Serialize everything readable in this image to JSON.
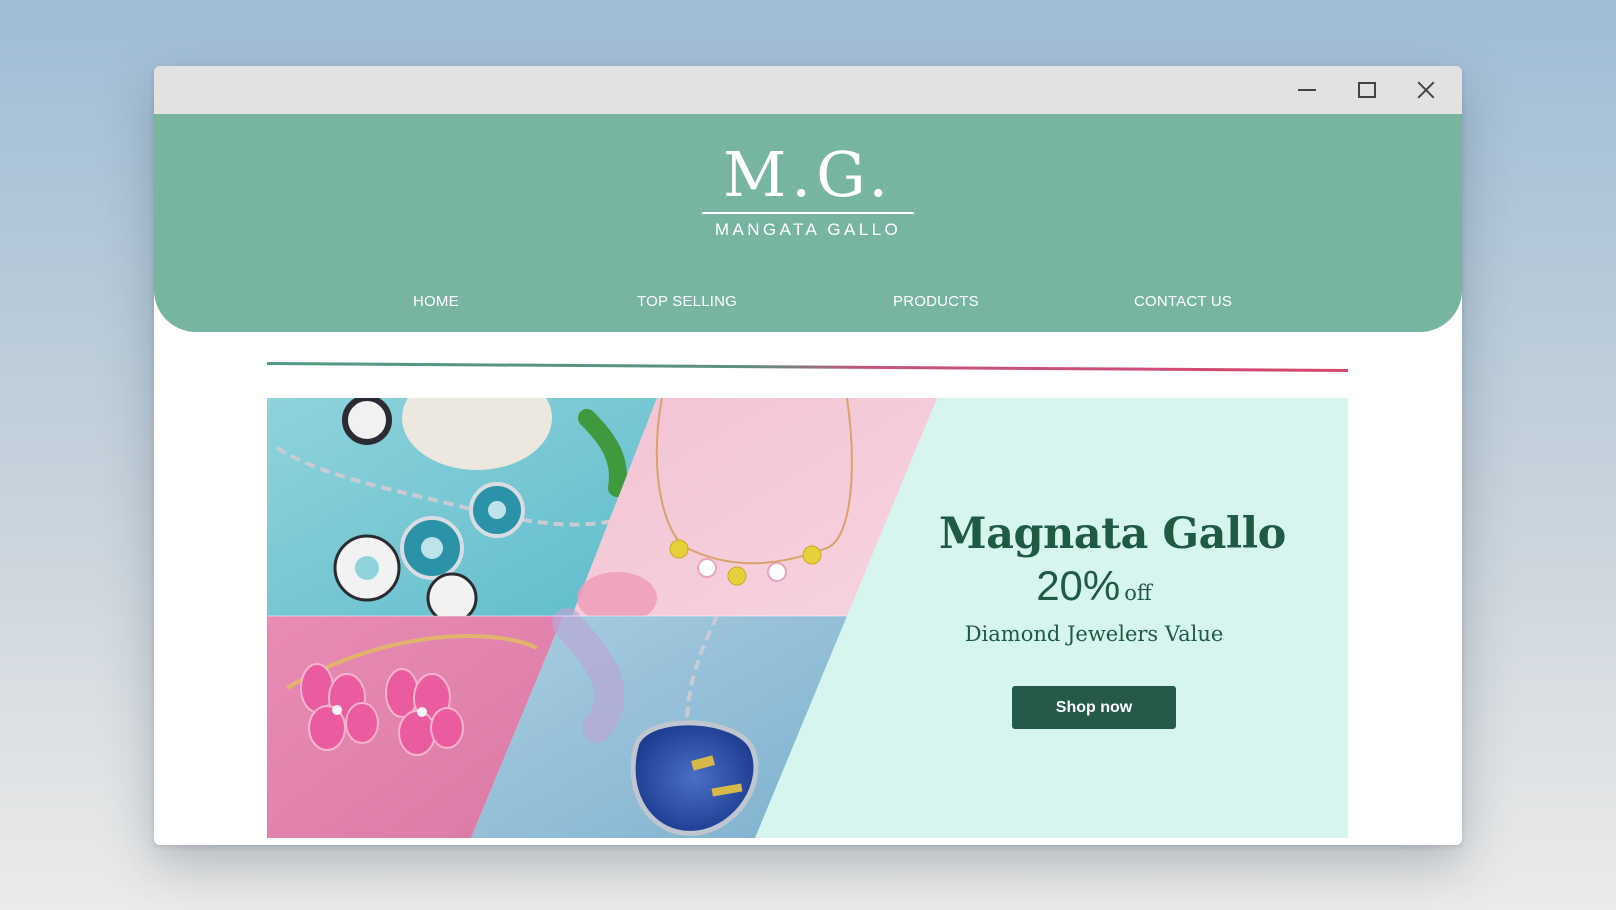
{
  "window": {
    "controls": {
      "minimize_icon": "minimize-icon",
      "maximize_icon": "maximize-icon",
      "close_icon": "close-icon"
    }
  },
  "brand": {
    "logo_mark": "M.G.",
    "logo_text": "MANGATA GALLO",
    "colors": {
      "header": "#77b5a2",
      "dark_green": "#25594a",
      "banner_bg": "#d6f5ef",
      "divider_start": "#4f9a84",
      "divider_end": "#d9456f"
    }
  },
  "nav": {
    "items": [
      {
        "label": "HOME"
      },
      {
        "label": "TOP SELLING"
      },
      {
        "label": "PRODUCTS"
      },
      {
        "label": "CONTACT US"
      }
    ]
  },
  "banner": {
    "title": "Magnata Gallo",
    "discount_value": "20%",
    "discount_suffix": "off",
    "subtitle": "Diamond Jewelers Value",
    "cta_label": "Shop now"
  }
}
